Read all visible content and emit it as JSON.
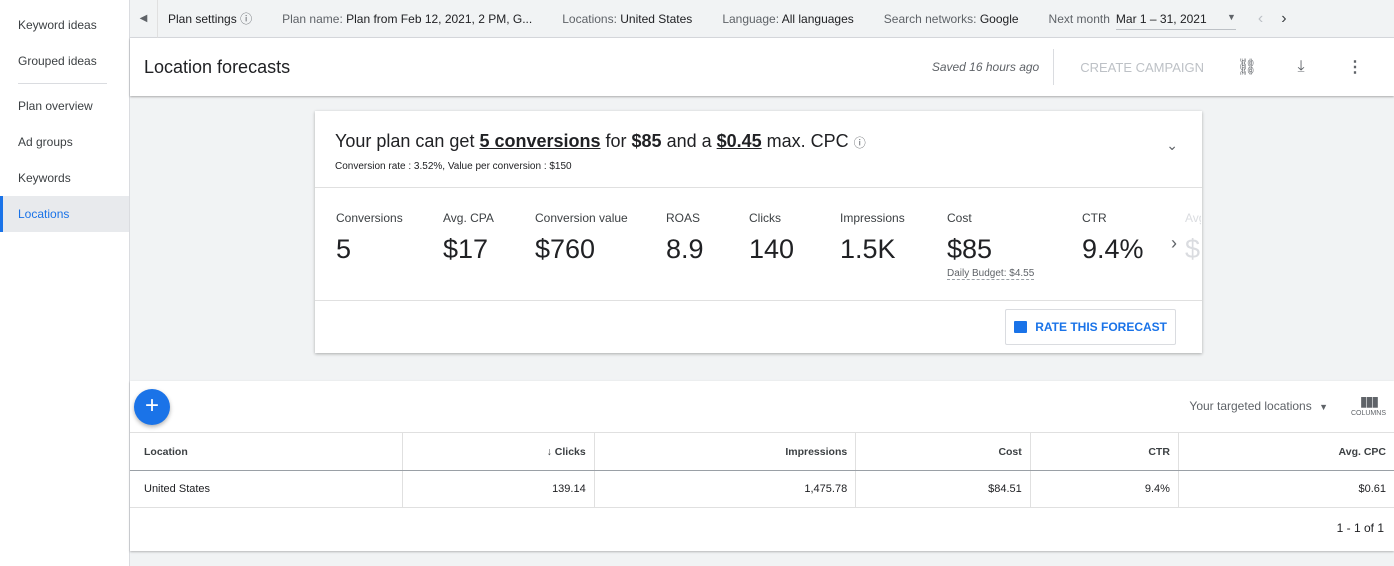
{
  "sidebar": {
    "items": [
      {
        "label": "Keyword ideas"
      },
      {
        "label": "Grouped ideas"
      },
      {
        "label": "Plan overview"
      },
      {
        "label": "Ad groups"
      },
      {
        "label": "Keywords"
      },
      {
        "label": "Locations"
      }
    ]
  },
  "topbar": {
    "plan_settings": "Plan settings",
    "plan_name_label": "Plan name:",
    "plan_name": "Plan from Feb 12, 2021, 2 PM, G...",
    "locations_label": "Locations:",
    "locations": "United States",
    "language_label": "Language:",
    "language": "All languages",
    "networks_label": "Search networks:",
    "networks": "Google",
    "range_label": "Next month",
    "range": "Mar 1 – 31, 2021"
  },
  "header": {
    "title": "Location forecasts",
    "saved": "Saved 16 hours ago",
    "create_campaign": "CREATE CAMPAIGN"
  },
  "summary": {
    "p1": "Your plan can get ",
    "conv": "5 conversions",
    "p2": " for ",
    "cost": "$85",
    "p3": " and a ",
    "cpc": "$0.45",
    "p4": " max. CPC",
    "sub": "Conversion rate : 3.52%, Value per conversion : $150"
  },
  "metrics": [
    {
      "label": "Conversions",
      "value": "5"
    },
    {
      "label": "Avg. CPA",
      "value": "$17"
    },
    {
      "label": "Conversion value",
      "value": "$760"
    },
    {
      "label": "ROAS",
      "value": "8.9"
    },
    {
      "label": "Clicks",
      "value": "140"
    },
    {
      "label": "Impressions",
      "value": "1.5K"
    },
    {
      "label": "Cost",
      "value": "$85",
      "note": "Daily Budget: $4.55"
    },
    {
      "label": "CTR",
      "value": "9.4%"
    },
    {
      "label": "Avg",
      "value": "$"
    }
  ],
  "rate": "RATE THIS FORECAST",
  "table": {
    "filter": "Your targeted locations",
    "columns_label": "COLUMNS",
    "headers": [
      "Location",
      "Clicks",
      "Impressions",
      "Cost",
      "CTR",
      "Avg. CPC"
    ],
    "rows": [
      [
        "United States",
        "139.14",
        "1,475.78",
        "$84.51",
        "9.4%",
        "$0.61"
      ]
    ],
    "pager": "1 - 1 of 1"
  },
  "colors": {
    "accent": "#1a73e8"
  }
}
